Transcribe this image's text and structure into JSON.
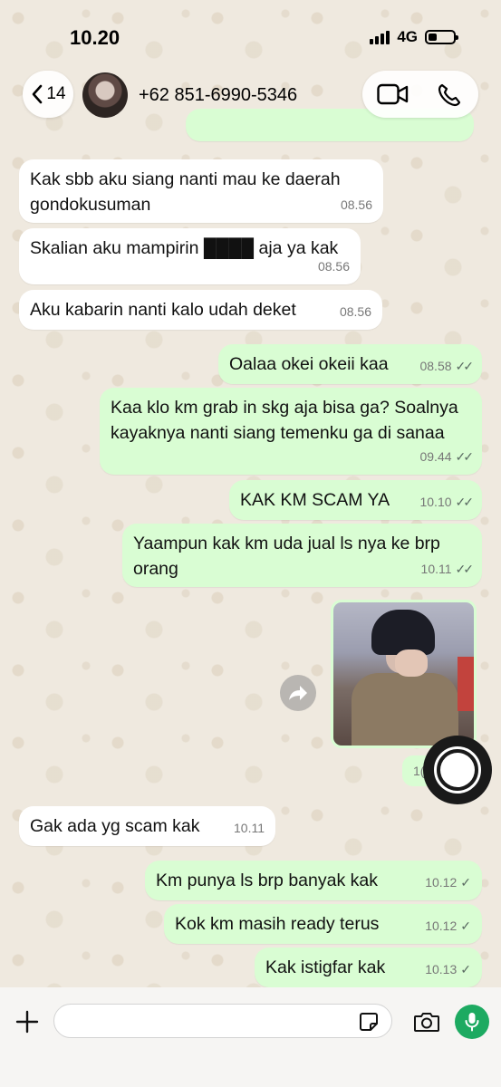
{
  "status_bar": {
    "time": "10.20",
    "network": "4G"
  },
  "header": {
    "back_count": "14",
    "contact_name": "+62 851-6990-5346"
  },
  "messages": [
    {
      "dir": "in",
      "text": "Kak sbb aku siang nanti mau ke daerah gondokusuman",
      "time": "08.56"
    },
    {
      "dir": "in",
      "text": "Skalian aku mampirin ████ aja ya kak",
      "time": "08.56"
    },
    {
      "dir": "in",
      "text": "Aku kabarin nanti kalo udah deket",
      "time": "08.56"
    },
    {
      "dir": "out",
      "text": "Oalaa okei okeii kaa",
      "time": "08.58",
      "ticks": "read"
    },
    {
      "dir": "out",
      "text": "Kaa klo km grab in skg aja bisa ga? Soalnya kayaknya nanti siang temenku ga di sanaa",
      "time": "09.44",
      "ticks": "read"
    },
    {
      "dir": "out",
      "text": "KAK KM SCAM YA",
      "time": "10.10",
      "ticks": "read"
    },
    {
      "dir": "out",
      "text": "Yaampun kak km uda jual ls nya ke brp orang",
      "time": "10.11",
      "ticks": "read"
    },
    {
      "dir": "out",
      "type": "image",
      "time_partial": "1("
    },
    {
      "dir": "in",
      "text": "Gak ada yg scam kak",
      "time": "10.11"
    },
    {
      "dir": "out",
      "text": "Km punya ls brp banyak kak",
      "time": "10.12",
      "ticks": "sent"
    },
    {
      "dir": "out",
      "text": "Kok km masih ready terus",
      "time": "10.12",
      "ticks": "sent"
    },
    {
      "dir": "out",
      "text": "Kak istigfar kak",
      "time": "10.13",
      "ticks": "sent"
    }
  ],
  "composer": {
    "value": "",
    "placeholder": ""
  },
  "colors": {
    "outgoing": "#d9fdd3",
    "incoming": "#ffffff",
    "mic": "#1daa61",
    "wallpaper": "#efe9df"
  }
}
